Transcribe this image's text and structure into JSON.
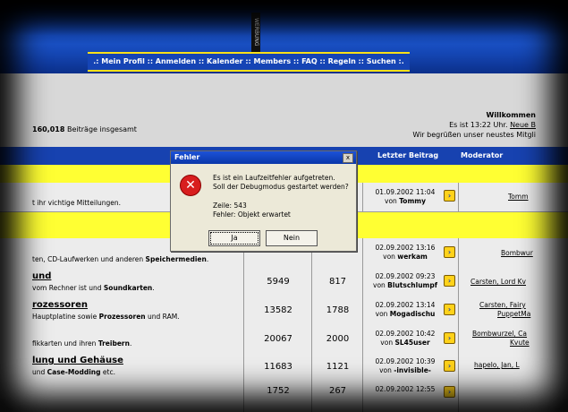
{
  "header": {
    "werbung": "WERBUNG",
    "nav": ".: Mein Profil :: Anmelden :: Kalender :: Members :: FAQ :: Regeln :: Suchen :."
  },
  "stats": {
    "total_prefix": "160,018",
    "total_suffix": " Beiträge insgesamt"
  },
  "welcome": {
    "line1": "Willkommen",
    "line2_prefix": "Es ist 13:22 Uhr. ",
    "line2_link": "Neue B",
    "line3": "Wir begrüßen unser neustes Mitgli"
  },
  "table": {
    "headers": {
      "last_post": "Letzter Beitrag",
      "moderator": "Moderator"
    },
    "row1": {
      "desc": "t ihr vichtige Mitteilungen.",
      "date": "01.09.2002 11:04",
      "by_prefix": "von ",
      "by": "Tommy",
      "mod": "Tomm"
    },
    "row2": {
      "desc_a": "ten, CD-Laufwerken und anderen ",
      "desc_b": "Speichermedien",
      "desc_c": ".",
      "date": "02.09.2002 13:16",
      "by_prefix": "von ",
      "by": "werkam",
      "mod": "Bombwur"
    },
    "row3": {
      "title": "und",
      "desc_a": " vom Rechner ist und ",
      "desc_b": "Soundkarten",
      "desc_c": ".",
      "threads": "5949",
      "posts": "817",
      "date": "02.09.2002 09:23",
      "by_prefix": "von ",
      "by": "Blutschlumpf",
      "mod": "Carsten, Lord Kv"
    },
    "row4": {
      "title": "rozessoren",
      "desc_a": "Hauptplatine sowie ",
      "desc_b": "Prozessoren",
      "desc_c": " und RAM.",
      "threads": "13582",
      "posts": "1788",
      "date": "02.09.2002 13:14",
      "by_prefix": "von ",
      "by": "Mogadischu",
      "mod1": "Carsten, Fairy",
      "mod2": "PuppetMa"
    },
    "row5": {
      "desc_a": "fikkarten und ihren ",
      "desc_b": "Treibern",
      "desc_c": ".",
      "threads": "20067",
      "posts": "2000",
      "date": "02.09.2002 10:42",
      "by_prefix": "von ",
      "by": "SL45user",
      "mod1": "Bombwurzel, Ca",
      "mod2": "Kvute"
    },
    "row6": {
      "title": "lung und Gehäuse",
      "desc_a": "und ",
      "desc_b": "Case-Modding",
      "desc_c": " etc.",
      "threads": "11683",
      "posts": "1121",
      "date": "02.09.2002 10:39",
      "by_prefix": "von ",
      "by": "-invisible-",
      "mod": "hapelo, Jan, L"
    },
    "row7": {
      "threads": "1752",
      "posts": "267",
      "date": "02.09.2002 12:55"
    }
  },
  "dialog": {
    "title": "Fehler",
    "close": "x",
    "line1": "Es ist ein Laufzeitfehler aufgetreten.",
    "line2": "Soll der Debugmodus gestartet werden?",
    "line3": "Zeile: 543",
    "line4": "Fehler: Objekt erwartet",
    "yes": "Ja",
    "no": "Nein"
  },
  "colors": {
    "header_blue": "#1742b0",
    "accent_yellow": "#ffff33",
    "error_red": "#d81e1e"
  }
}
